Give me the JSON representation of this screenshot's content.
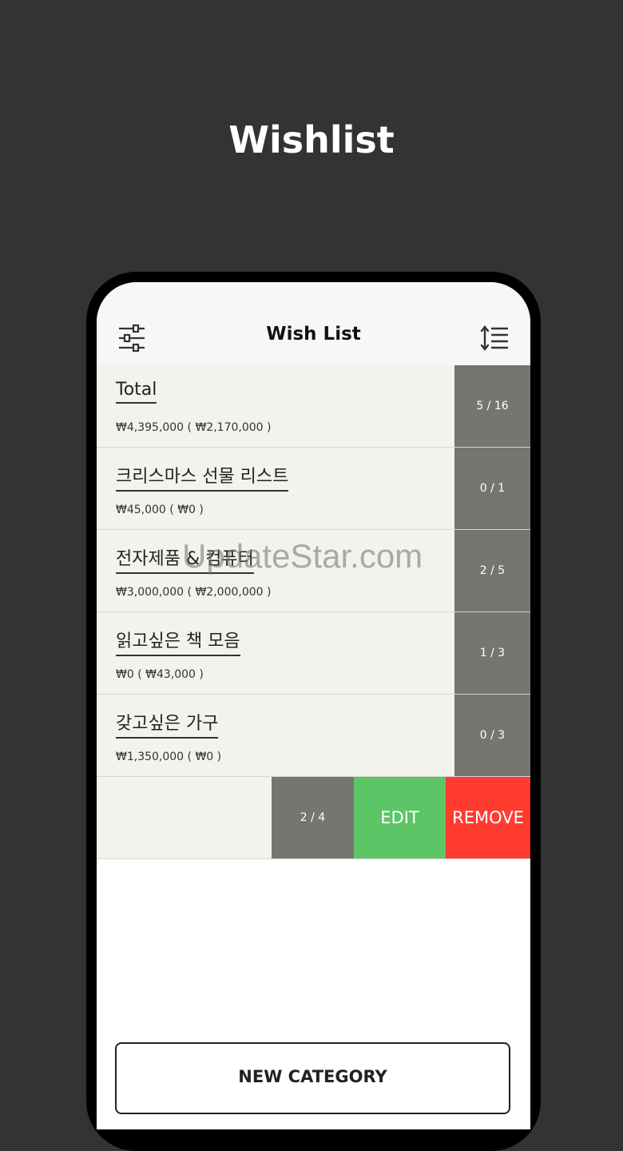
{
  "promo": {
    "title": "Wishlist"
  },
  "navbar": {
    "title": "Wish List"
  },
  "icons": {
    "left": "sliders-icon",
    "right": "sort-icon"
  },
  "colors": {
    "row_bg": "#f3f2ec",
    "count_bg": "#77756f",
    "edit": "#5cc566",
    "remove": "#ff3b30"
  },
  "rows": [
    {
      "title": "Total",
      "price": "₩4,395,000 ( ₩2,170,000 )",
      "count": "5 / 16"
    },
    {
      "title": "크리스마스 선물 리스트",
      "price": "₩45,000 ( ₩0 )",
      "count": "0 / 1"
    },
    {
      "title": "전자제품 & 컴퓨터",
      "price": "₩3,000,000 ( ₩2,000,000 )",
      "count": "2 / 5"
    },
    {
      "title": "읽고싶은 책 모음",
      "price": "₩0 ( ₩43,000 )",
      "count": "1 / 3"
    },
    {
      "title": "갖고싶은 가구",
      "price": "₩1,350,000 ( ₩0 )",
      "count": "0 / 3"
    }
  ],
  "swipe_row": {
    "count": "2 / 4",
    "edit_label": "EDIT",
    "remove_label": "REMOVE"
  },
  "new_category_label": "NEW CATEGORY",
  "watermark": "UpdateStar.com"
}
